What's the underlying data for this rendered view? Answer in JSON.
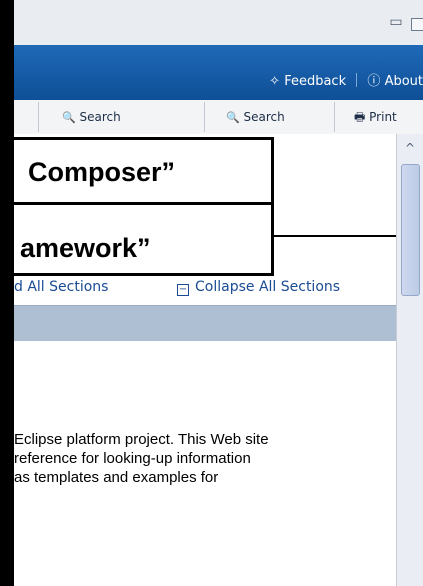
{
  "window": {
    "minimize_glyph": "▭",
    "maximize_glyph": "□"
  },
  "banner": {
    "feedback": "Feedback",
    "about": "About",
    "feedback_icon": "✧",
    "about_icon": "ⓘ"
  },
  "toolbar": {
    "search1": "Search",
    "search2": "Search",
    "print": "Print",
    "search_icon": "🔍",
    "print_icon": "🖶"
  },
  "overlay": {
    "line1": "Composer”",
    "line2": "amework”"
  },
  "sections": {
    "expand": "d All Sections",
    "collapse": "Collapse All Sections",
    "collapse_icon": "−"
  },
  "scrollbar": {
    "up_icon": "^"
  },
  "paragraph": [
    "Eclipse platform project. This Web site",
    "reference for looking-up information",
    "as templates and examples for"
  ]
}
